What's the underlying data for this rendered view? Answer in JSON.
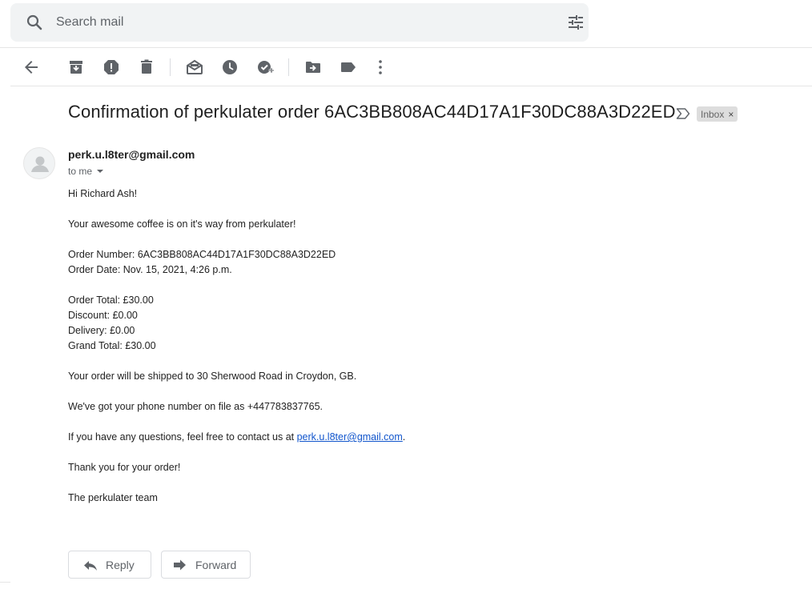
{
  "search": {
    "placeholder": "Search mail"
  },
  "toolbar": {
    "buttons": [
      "back-icon",
      "archive-icon",
      "report-spam-icon",
      "delete-icon",
      "mark-unread-icon",
      "snooze-icon",
      "add-to-tasks-icon",
      "move-to-icon",
      "label-icon",
      "more-icon"
    ]
  },
  "email": {
    "subject": "Confirmation of perkulater order 6AC3BB808AC44D17A1F30DC88A3D22ED",
    "label": "Inbox",
    "label_remove": "×",
    "sender": "perk.u.l8ter@gmail.com",
    "recipient": "to me",
    "body": {
      "greeting": "Hi Richard Ash!",
      "intro": "Your awesome coffee is on it's way from perkulater!",
      "order_number": "Order Number: 6AC3BB808AC44D17A1F30DC88A3D22ED",
      "order_date": "Order Date: Nov. 15, 2021, 4:26 p.m.",
      "order_total": "Order Total: £30.00",
      "discount": "Discount: £0.00",
      "delivery": "Delivery: £0.00",
      "grand_total": "Grand Total: £30.00",
      "shipping": "Your order will be shipped to 30 Sherwood Road in Croydon, GB.",
      "phone": "We've got your phone number on file as +447783837765.",
      "contact_prefix": "If you have any questions, feel free to contact us at ",
      "contact_link": "perk.u.l8ter@gmail.com",
      "contact_suffix": ".",
      "thanks": "Thank you for your order!",
      "signoff": "The perkulater team"
    }
  },
  "actions": {
    "reply": "Reply",
    "forward": "Forward"
  },
  "colors": {
    "icon": "#5f6368",
    "link": "#1155cc",
    "search_bg": "#f1f3f4",
    "chip_bg": "#dddddd"
  }
}
